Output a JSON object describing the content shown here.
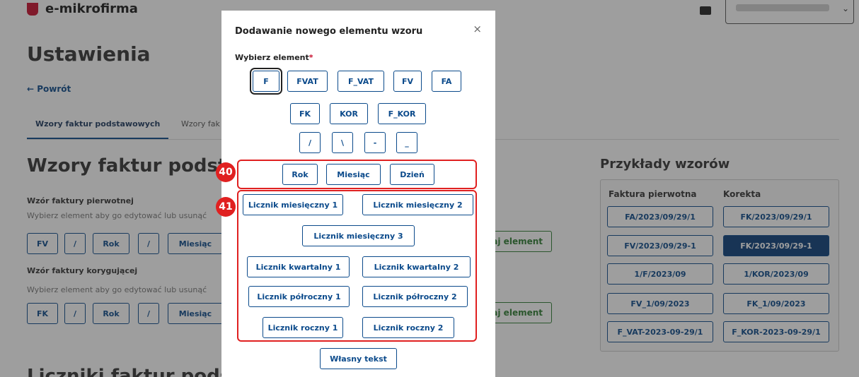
{
  "app": {
    "name": "e-mikrofirma"
  },
  "page": {
    "title": "Ustawienia",
    "back_link": "← Powrót",
    "tabs": [
      {
        "label": "Wzory faktur podstawowych"
      },
      {
        "label": "Wzory fak"
      }
    ],
    "section_title": "Wzory faktur podsta",
    "original_pattern": {
      "label": "Wzór faktury pierwotnej",
      "hint": "Wybierz element aby go edytować lub usunąć",
      "chips": [
        "FV",
        "/",
        "Rok",
        "/",
        "Miesiąc"
      ]
    },
    "correction_pattern": {
      "label": "Wzór faktury korygującej",
      "hint": "Wybierz element aby go edytować lub usunąć",
      "chips": [
        "FK",
        "/",
        "Rok",
        "/",
        "Miesiąc"
      ]
    },
    "add_element_label": "aj element",
    "next_section_title": "Liczniki faktur podsta"
  },
  "examples": {
    "title": "Przykłady wzorów",
    "col_original": "Faktura pierwotna",
    "col_correction": "Korekta",
    "original": [
      "FA/2023/09/29/1",
      "FV/2023/09/29-1",
      "1/F/2023/09",
      "FV_1/09/2023",
      "F_VAT-2023-09-29/1"
    ],
    "correction": [
      "FK/2023/09/29/1",
      "FK/2023/09/29-1",
      "1/KOR/2023/09",
      "FK_1/09/2023",
      "F_KOR-2023-09-29/1"
    ],
    "selected_correction_index": 1
  },
  "modal": {
    "title": "Dodawanie nowego elementu wzoru",
    "close": "×",
    "field_label": "Wybierz element",
    "required_mark": "*",
    "row1": [
      "F",
      "FVAT",
      "F_VAT",
      "FV",
      "FA"
    ],
    "row2": [
      "FK",
      "KOR",
      "F_KOR"
    ],
    "row3": [
      "/",
      "\\",
      "-",
      "_"
    ],
    "date_group": [
      "Rok",
      "Miesiąc",
      "Dzień"
    ],
    "counter_group": {
      "row1": [
        "Licznik miesięczny 1",
        "Licznik miesięczny 2"
      ],
      "row2": [
        "Licznik miesięczny 3"
      ],
      "row3": [
        "Licznik kwartalny 1",
        "Licznik kwartalny 2"
      ],
      "row4": [
        "Licznik półroczny 1",
        "Licznik półroczny 2"
      ],
      "row5": [
        "Licznik roczny 1",
        "Licznik roczny 2"
      ]
    },
    "custom_text": "Własny tekst"
  },
  "annotations": [
    {
      "label": "40"
    },
    {
      "label": "41"
    }
  ],
  "colors": {
    "primary": "#0b4a8b",
    "selected_bg": "#0b3f7a",
    "add_green": "#2e7d32",
    "annotation_red": "#e02020",
    "required_red": "#c8102e"
  }
}
